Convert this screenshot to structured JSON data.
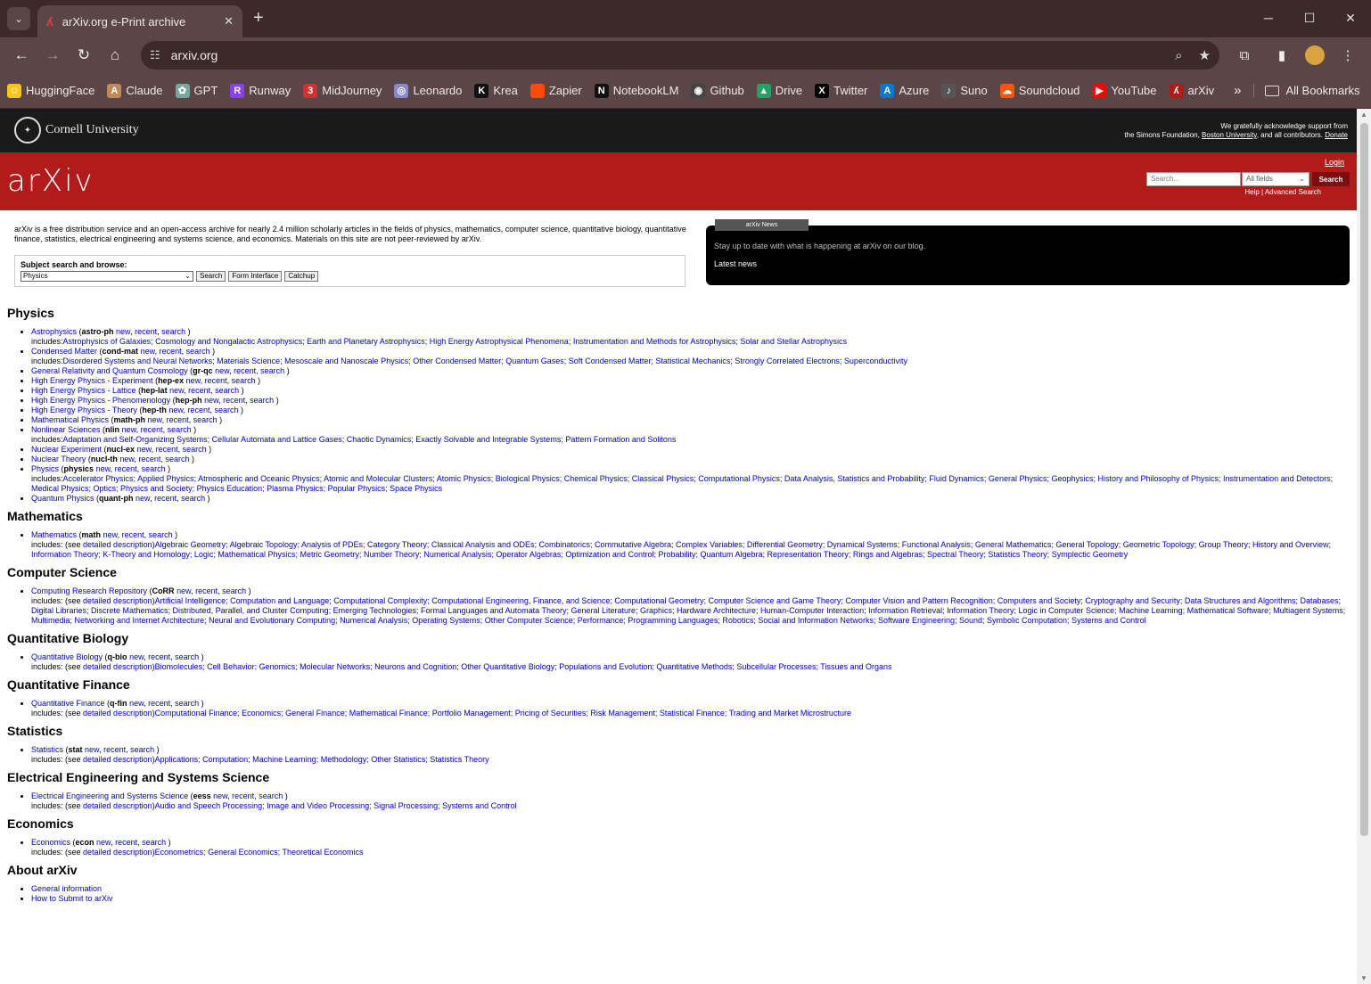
{
  "browser": {
    "tab_title": "arXiv.org e-Print archive",
    "url": "arxiv.org",
    "bookmarks": [
      {
        "label": "HuggingFace",
        "color": "#f5c518",
        "glyph": "☺"
      },
      {
        "label": "Claude",
        "color": "#c08a5a",
        "glyph": "A"
      },
      {
        "label": "GPT",
        "color": "#74aa9c",
        "glyph": "✿"
      },
      {
        "label": "Runway",
        "color": "#8a3ffc",
        "glyph": "R"
      },
      {
        "label": "MidJourney",
        "color": "#d03030",
        "glyph": "3"
      },
      {
        "label": "Leonardo",
        "color": "#8888cc",
        "glyph": "◎"
      },
      {
        "label": "Krea",
        "color": "#111111",
        "glyph": "K"
      },
      {
        "label": "Zapier",
        "color": "#ff4a00",
        "glyph": ""
      },
      {
        "label": "NotebookLM",
        "color": "#111111",
        "glyph": "N"
      },
      {
        "label": "Github",
        "color": "#444444",
        "glyph": "◉"
      },
      {
        "label": "Drive",
        "color": "#1fa463",
        "glyph": "▲"
      },
      {
        "label": "Twitter",
        "color": "#000000",
        "glyph": "X"
      },
      {
        "label": "Azure",
        "color": "#0078d4",
        "glyph": "A"
      },
      {
        "label": "Suno",
        "color": "#555555",
        "glyph": "♪"
      },
      {
        "label": "Soundcloud",
        "color": "#ff5500",
        "glyph": "☁"
      },
      {
        "label": "YouTube",
        "color": "#ff0000",
        "glyph": "▶"
      },
      {
        "label": "arXiv",
        "color": "#b31b1b",
        "glyph": "ʎ"
      }
    ],
    "all_bookmarks": "All Bookmarks"
  },
  "header": {
    "university": "Cornell University",
    "ack_line1": "We gratefully acknowledge support from",
    "ack_line2_pre": "the Simons Foundation,",
    "ack_link": "Boston University",
    "ack_line2_post": ", and all contributors.",
    "donate": "Donate",
    "logo": "arXiv",
    "login": "Login",
    "search_placeholder": "Search...",
    "field_select": "All fields",
    "search_button": "Search",
    "help": "Help | Advanced Search"
  },
  "intro": {
    "text": "arXiv is a free distribution service and an open-access archive for nearly 2.4 million scholarly articles in the fields of physics, mathematics, computer science, quantitative biology, quantitative finance, statistics, electrical engineering and systems science, and economics. Materials on this site are not peer-reviewed by arXiv.",
    "subject_label": "Subject search and browse:",
    "subject_value": "Physics",
    "btn_search": "Search",
    "btn_form": "Form Interface",
    "btn_catchup": "Catchup"
  },
  "news": {
    "tab": "arXiv News",
    "text": "Stay up to date with what is happening at arXiv on our blog.",
    "link": "Latest news"
  },
  "sections": [
    {
      "title": "Physics",
      "items": [
        {
          "name": "Astrophysics",
          "code": "astro-ph",
          "inc": "includes:",
          "inc_links": "Astrophysics of Galaxies; Cosmology and Nongalactic Astrophysics; Earth and Planetary Astrophysics; High Energy Astrophysical Phenomena; Instrumentation and Methods for Astrophysics; Solar and Stellar Astrophysics"
        },
        {
          "name": "Condensed Matter",
          "code": "cond-mat",
          "inc": "includes:",
          "inc_links": "Disordered Systems and Neural Networks; Materials Science; Mesoscale and Nanoscale Physics; Other Condensed Matter; Quantum Gases; Soft Condensed Matter; Statistical Mechanics; Strongly Correlated Electrons; Superconductivity"
        },
        {
          "name": "General Relativity and Quantum Cosmology",
          "code": "gr-qc"
        },
        {
          "name": "High Energy Physics - Experiment",
          "code": "hep-ex"
        },
        {
          "name": "High Energy Physics - Lattice",
          "code": "hep-lat"
        },
        {
          "name": "High Energy Physics - Phenomenology",
          "code": "hep-ph"
        },
        {
          "name": "High Energy Physics - Theory",
          "code": "hep-th"
        },
        {
          "name": "Mathematical Physics",
          "code": "math-ph"
        },
        {
          "name": "Nonlinear Sciences",
          "code": "nlin",
          "inc": "includes:",
          "inc_links": "Adaptation and Self-Organizing Systems; Cellular Automata and Lattice Gases; Chaotic Dynamics; Exactly Solvable and Integrable Systems; Pattern Formation and Solitons"
        },
        {
          "name": "Nuclear Experiment",
          "code": "nucl-ex"
        },
        {
          "name": "Nuclear Theory",
          "code": "nucl-th"
        },
        {
          "name": "Physics",
          "code": "physics",
          "inc": "includes:",
          "inc_links": "Accelerator Physics; Applied Physics; Atmospheric and Oceanic Physics; Atomic and Molecular Clusters; Atomic Physics; Biological Physics; Chemical Physics; Classical Physics; Computational Physics; Data Analysis, Statistics and Probability; Fluid Dynamics; General Physics; Geophysics; History and Philosophy of Physics; Instrumentation and Detectors; Medical Physics; Optics; Physics and Society; Physics Education; Plasma Physics; Popular Physics; Space Physics"
        },
        {
          "name": "Quantum Physics",
          "code": "quant-ph"
        }
      ]
    },
    {
      "title": "Mathematics",
      "items": [
        {
          "name": "Mathematics",
          "code": "math",
          "inc": "includes: (see ",
          "inc_detail": "detailed description)",
          "inc_links": "Algebraic Geometry; Algebraic Topology; Analysis of PDEs; Category Theory; Classical Analysis and ODEs; Combinatorics; Commutative Algebra; Complex Variables; Differential Geometry; Dynamical Systems; Functional Analysis; General Mathematics; General Topology; Geometric Topology; Group Theory; History and Overview; Information Theory; K-Theory and Homology; Logic; Mathematical Physics; Metric Geometry; Number Theory; Numerical Analysis; Operator Algebras; Optimization and Control; Probability; Quantum Algebra; Representation Theory; Rings and Algebras; Spectral Theory; Statistics Theory; Symplectic Geometry"
        }
      ]
    },
    {
      "title": "Computer Science",
      "items": [
        {
          "name": "Computing Research Repository",
          "code": "CoRR",
          "inc": "includes: (see ",
          "inc_detail": "detailed description)",
          "inc_links": "Artificial Intelligence; Computation and Language; Computational Complexity; Computational Engineering, Finance, and Science; Computational Geometry; Computer Science and Game Theory; Computer Vision and Pattern Recognition; Computers and Society; Cryptography and Security; Data Structures and Algorithms; Databases; Digital Libraries; Discrete Mathematics; Distributed, Parallel, and Cluster Computing; Emerging Technologies; Formal Languages and Automata Theory; General Literature; Graphics; Hardware Architecture; Human-Computer Interaction; Information Retrieval; Information Theory; Logic in Computer Science; Machine Learning; Mathematical Software; Multiagent Systems; Multimedia; Networking and Internet Architecture; Neural and Evolutionary Computing; Numerical Analysis; Operating Systems; Other Computer Science; Performance; Programming Languages; Robotics; Social and Information Networks; Software Engineering; Sound; Symbolic Computation; Systems and Control"
        }
      ]
    },
    {
      "title": "Quantitative Biology",
      "items": [
        {
          "name": "Quantitative Biology",
          "code": "q-bio",
          "inc": "includes: (see ",
          "inc_detail": "detailed description)",
          "inc_links": "Biomolecules; Cell Behavior; Genomics; Molecular Networks; Neurons and Cognition; Other Quantitative Biology; Populations and Evolution; Quantitative Methods; Subcellular Processes; Tissues and Organs"
        }
      ]
    },
    {
      "title": "Quantitative Finance",
      "items": [
        {
          "name": "Quantitative Finance",
          "code": "q-fin",
          "inc": "includes: (see ",
          "inc_detail": "detailed description)",
          "inc_links": "Computational Finance; Economics; General Finance; Mathematical Finance; Portfolio Management; Pricing of Securities; Risk Management; Statistical Finance; Trading and Market Microstructure"
        }
      ]
    },
    {
      "title": "Statistics",
      "items": [
        {
          "name": "Statistics",
          "code": "stat",
          "inc": "includes: (see ",
          "inc_detail": "detailed description)",
          "inc_links": "Applications; Computation; Machine Learning; Methodology; Other Statistics; Statistics Theory"
        }
      ]
    },
    {
      "title": "Electrical Engineering and Systems Science",
      "items": [
        {
          "name": "Electrical Engineering and Systems Science",
          "code": "eess",
          "inc": "includes: (see ",
          "inc_detail": "detailed description)",
          "inc_links": "Audio and Speech Processing; Image and Video Processing; Signal Processing; Systems and Control"
        }
      ]
    },
    {
      "title": "Economics",
      "items": [
        {
          "name": "Economics",
          "code": "econ",
          "inc": "includes: (see ",
          "inc_detail": "detailed description)",
          "inc_links": "Econometrics; General Economics; Theoretical Economics"
        }
      ]
    },
    {
      "title": "About arXiv",
      "items": [
        {
          "name": "General information",
          "plain": true
        },
        {
          "name": "How to Submit to arXiv",
          "plain": true
        }
      ]
    }
  ],
  "link_words": {
    "new": "new",
    "recent": "recent",
    "search": "search"
  }
}
